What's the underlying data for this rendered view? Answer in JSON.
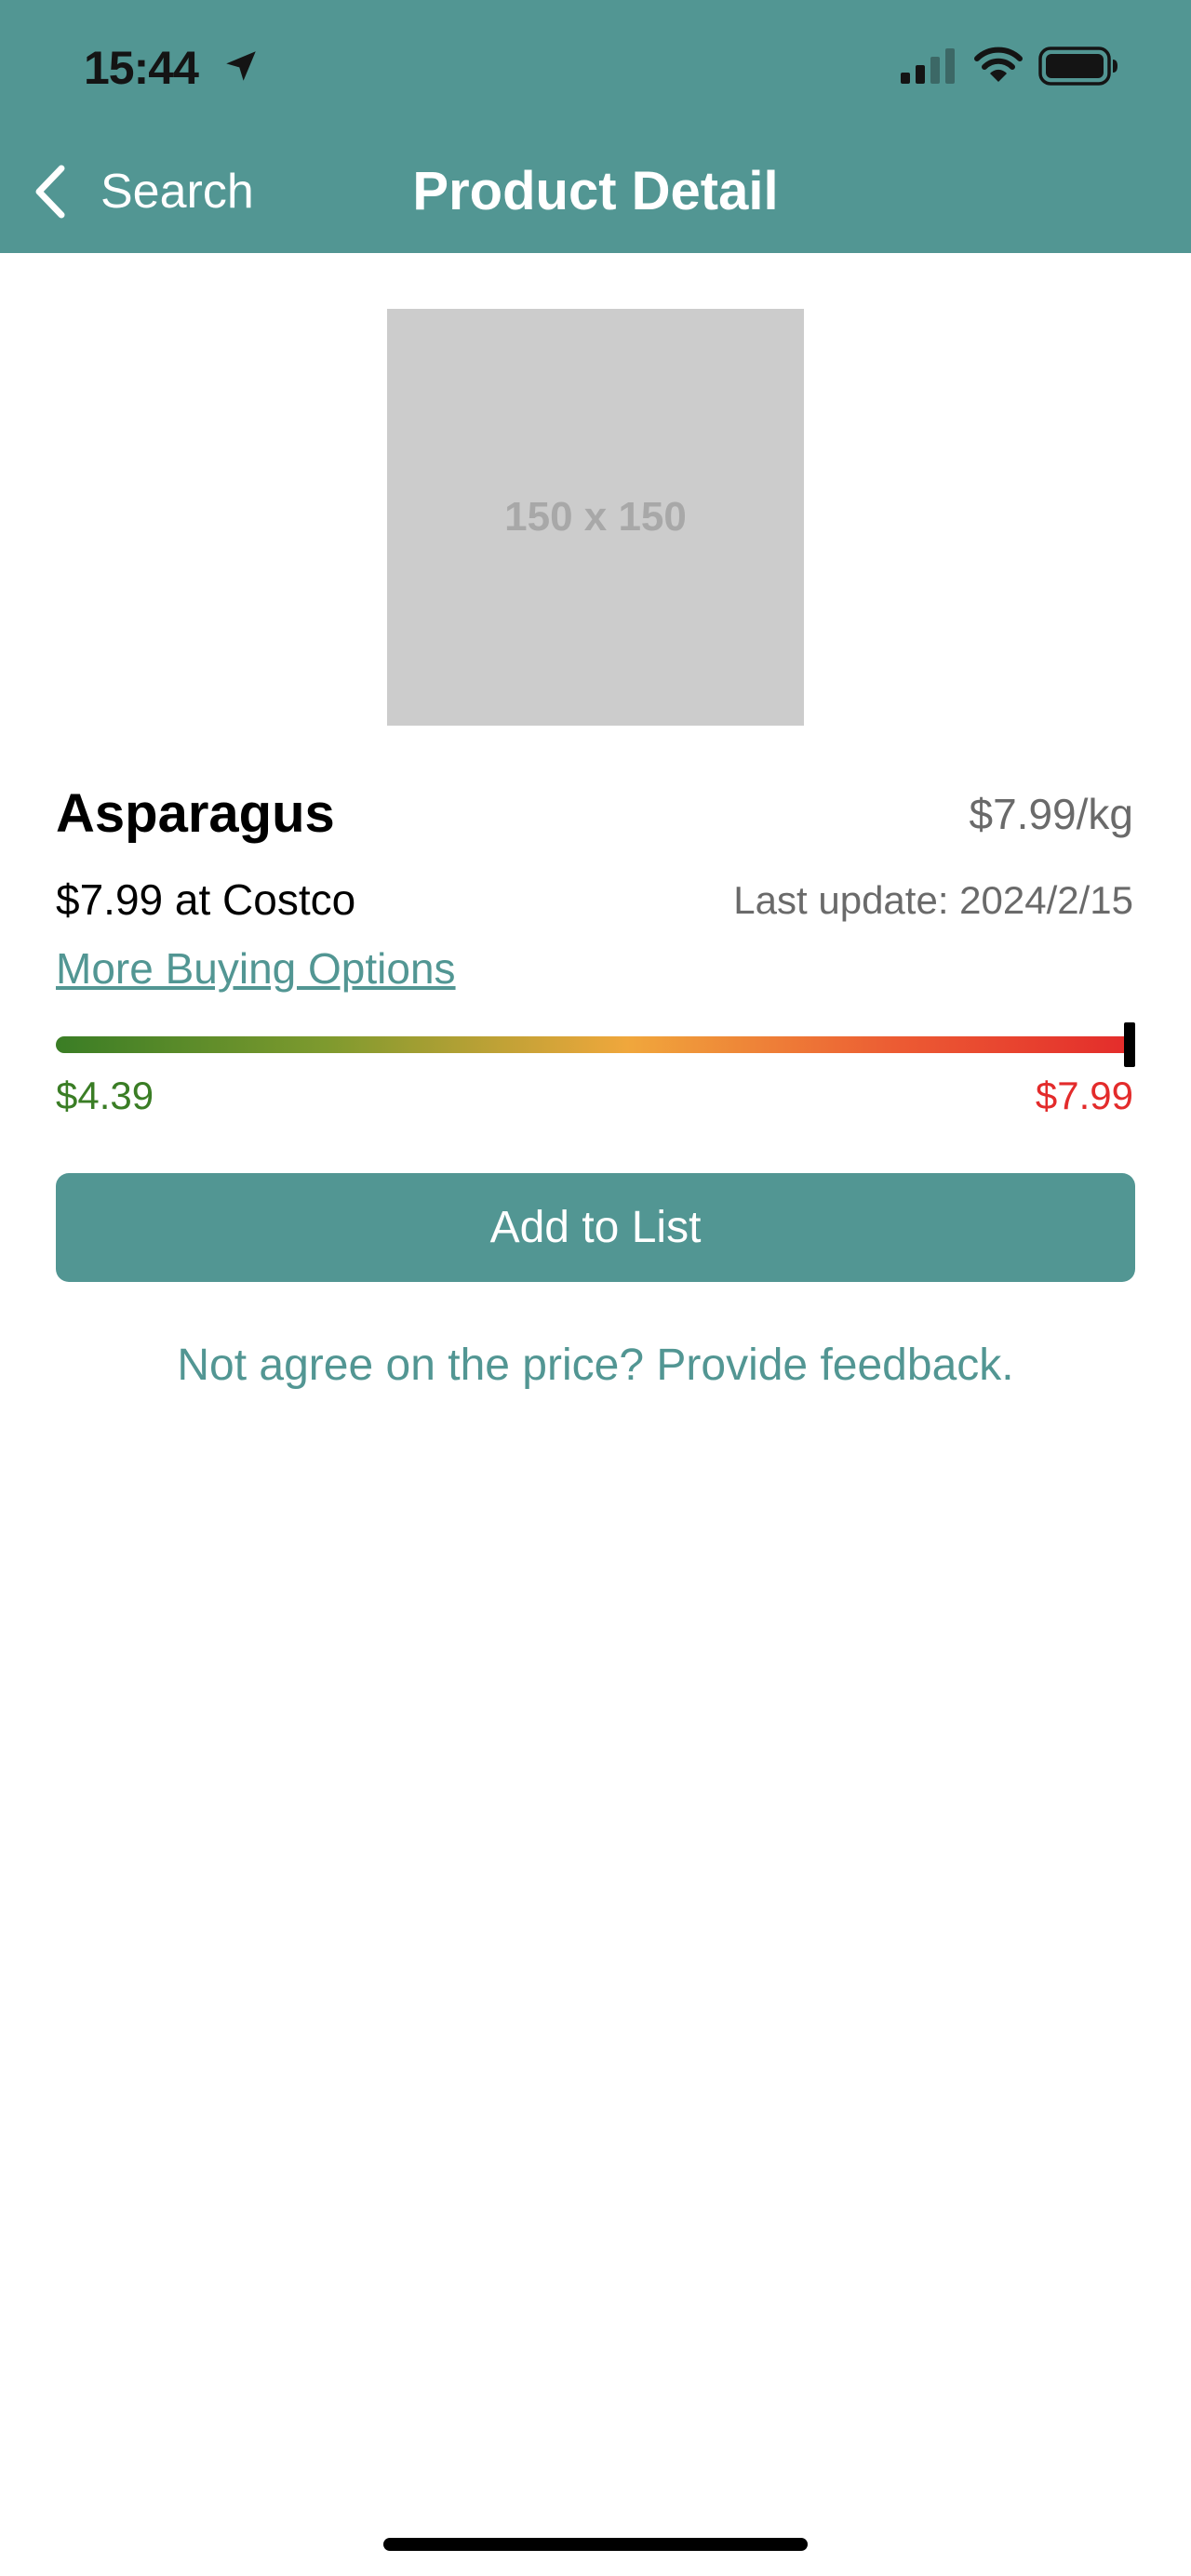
{
  "status_bar": {
    "time": "15:44"
  },
  "nav": {
    "back_label": "Search",
    "title": "Product Detail"
  },
  "product": {
    "image_placeholder": "150 x 150",
    "name": "Asparagus",
    "unit_price": "$7.99/kg",
    "store_price": "$7.99 at Costco",
    "last_update": "Last update: 2024/2/15",
    "more_options_label": "More Buying Options"
  },
  "price_range": {
    "min_label": "$4.39",
    "max_label": "$7.99",
    "min": 4.39,
    "max": 7.99,
    "current": 7.99,
    "colors": {
      "low": "#3a7d25",
      "mid": "#f0a73c",
      "high": "#e32b2b"
    }
  },
  "actions": {
    "add_to_list_label": "Add to List",
    "feedback_label": "Not agree on the price? Provide feedback."
  },
  "theme": {
    "accent": "#529693"
  }
}
